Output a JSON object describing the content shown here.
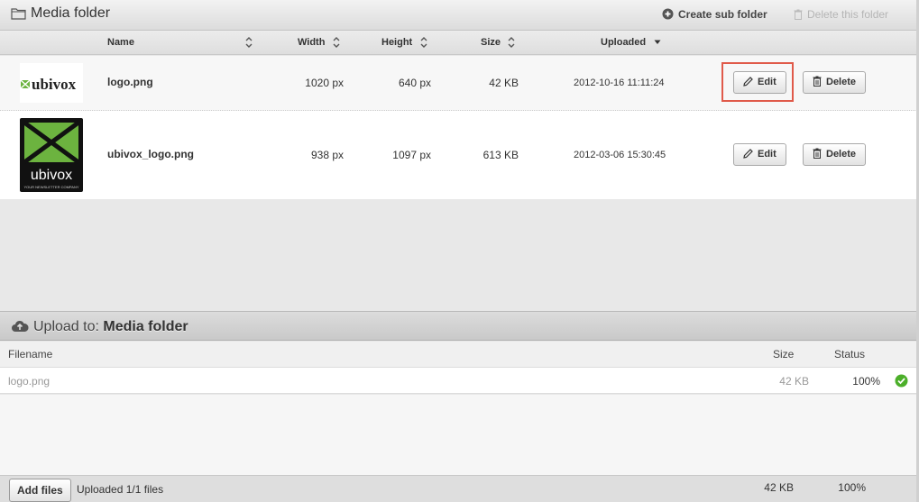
{
  "media_folder": {
    "title": "Media folder",
    "create_sub_folder": "Create sub folder",
    "delete_this_folder": "Delete this folder"
  },
  "columns": {
    "name": "Name",
    "width": "Width",
    "height": "Height",
    "size": "Size",
    "uploaded": "Uploaded"
  },
  "files": [
    {
      "name": "logo.png",
      "width": "1020 px",
      "height": "640 px",
      "size": "42 KB",
      "uploaded": "2012-10-16 11:11:24",
      "thumb_text": "ubivox"
    },
    {
      "name": "ubivox_logo.png",
      "width": "938 px",
      "height": "1097 px",
      "size": "613 KB",
      "uploaded": "2012-03-06 15:30:45",
      "thumb_text": "ubivox",
      "thumb_subtext": "YOUR NEWSLETTER COMPANY"
    }
  ],
  "buttons": {
    "edit": "Edit",
    "delete": "Delete"
  },
  "upload": {
    "label": "Upload to:",
    "target": "Media folder",
    "columns": {
      "filename": "Filename",
      "size": "Size",
      "status": "Status"
    },
    "rows": [
      {
        "filename": "logo.png",
        "size": "42 KB",
        "status": "100%"
      }
    ],
    "add_files": "Add files",
    "summary": "Uploaded 1/1 files",
    "total_size": "42 KB",
    "total_status": "100%"
  },
  "colors": {
    "brand_green": "#6cb33f",
    "highlight": "#e05a4a",
    "success": "#4caf2a"
  },
  "icons": [
    "folder-icon",
    "plus-circle-icon",
    "trash-icon",
    "sort-icon",
    "sort-down-icon",
    "pencil-icon",
    "cloud-upload-icon",
    "check-circle-icon"
  ]
}
